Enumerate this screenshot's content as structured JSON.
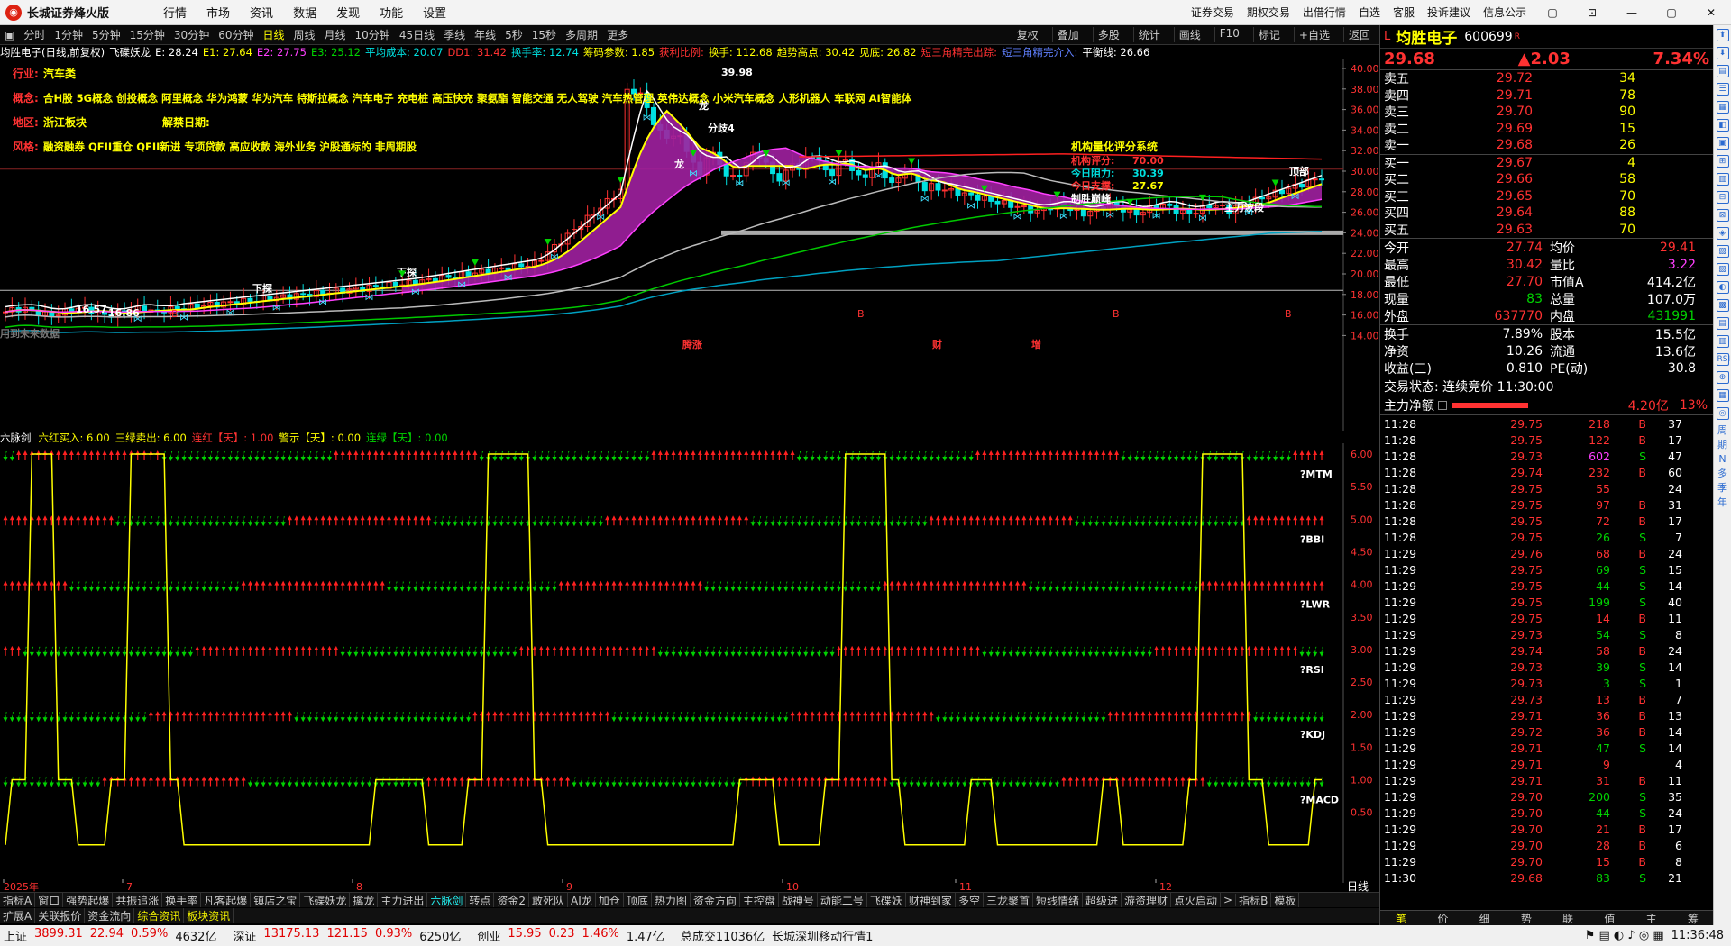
{
  "window": {
    "title": "长城证券烽火版",
    "menu": [
      "行情",
      "市场",
      "资讯",
      "数据",
      "发现",
      "功能",
      "设置"
    ],
    "right_links": [
      "证券交易",
      "期权交易",
      "出借行情",
      "自选",
      "客服",
      "投诉建议",
      "信息公示"
    ],
    "controls": [
      "▢",
      "⊡",
      "—",
      "▢",
      "✕"
    ]
  },
  "toolbar": {
    "periods": [
      "分时",
      "1分钟",
      "5分钟",
      "15分钟",
      "30分钟",
      "60分钟",
      "日线",
      "周线",
      "月线",
      "10分钟",
      "45日线",
      "季线",
      "年线",
      "5秒",
      "15秒",
      "多周期",
      "更多"
    ],
    "active": "日线",
    "right_buttons": [
      "复权",
      "叠加",
      "多股",
      "统计",
      "画线",
      "F10",
      "标记",
      "+自选",
      "返回"
    ]
  },
  "info_line": [
    {
      "t": "均胜电子(日线,前复权)",
      "c": "w"
    },
    {
      "t": "飞碟妖龙",
      "c": "w"
    },
    {
      "t": "E: 28.24",
      "c": "w"
    },
    {
      "t": "E1: 27.64",
      "c": "y"
    },
    {
      "t": "E2: 27.75",
      "c": "m"
    },
    {
      "t": "E3: 25.12",
      "c": "g"
    },
    {
      "t": "平均成本: 20.07",
      "c": "c"
    },
    {
      "t": "DD1: 31.42",
      "c": "r"
    },
    {
      "t": "换手率: 12.74",
      "c": "c"
    },
    {
      "t": "筹码参数: 1.85",
      "c": "y"
    },
    {
      "t": "获利比例:",
      "c": "r"
    },
    {
      "t": "换手: 112.68",
      "c": "y"
    },
    {
      "t": "趋势高点: 30.42",
      "c": "y"
    },
    {
      "t": "见底: 26.82",
      "c": "y"
    },
    {
      "t": "短三角精完出踪:",
      "c": "r"
    },
    {
      "t": "短三角精完介入:",
      "c": "b"
    },
    {
      "t": "平衡线: 26.66",
      "c": "w"
    }
  ],
  "annotations": {
    "industry": {
      "label": "行业:",
      "value": "汽车类"
    },
    "concepts": {
      "label": "概念:",
      "value": "合H股 5G概念 创投概念 阿里概念 华为鸿蒙 华为汽车 特斯拉概念 汽车电子 充电桩 高压快充 聚氨酯 智能交通 无人驾驶 汽车热管理 英伟达概念 小米汽车概念 人形机器人 车联网 AI智能体"
    },
    "region": {
      "label": "地区:",
      "value": "浙江板块"
    },
    "unlock": {
      "label": "解禁日期:",
      "value": ""
    },
    "style": {
      "label": "风格:",
      "value": "融资融券 QFII重仓 QFII新进 专项贷款 高应收款 海外业务 沪股通标的 非周期股"
    },
    "jigou": {
      "title": "机构量化评分系统",
      "score_label": "机构评分:",
      "score": "70.00",
      "resist_label": "今日阻力:",
      "resist": "30.39",
      "support_label": "今日支撑:",
      "support": "27.67",
      "verdict": "制胜巅峰"
    },
    "peak_label": "39.98",
    "low_labels": [
      "16.57",
      "16.86"
    ],
    "no_data": "用到未来数据",
    "bottom_marks": [
      "腾涨",
      "财",
      "增"
    ],
    "chart_words": [
      "龙",
      "龙",
      "分歧4",
      "主力波段",
      "下探",
      "下探",
      "顶部"
    ]
  },
  "price_axis": {
    "ticks": [
      "40.00",
      "38.00",
      "36.00",
      "34.00",
      "32.00",
      "30.00",
      "28.00",
      "26.00",
      "24.00",
      "22.00",
      "20.00",
      "18.00",
      "16.00",
      "14.00"
    ]
  },
  "sub_indicator": {
    "name": "六脉剑",
    "items": [
      {
        "t": "六红买入: 6.00",
        "c": "y"
      },
      {
        "t": "三绿卖出: 6.00",
        "c": "y"
      },
      {
        "t": "连红【天】: 1.00",
        "c": "r"
      },
      {
        "t": "警示【天】: 0.00",
        "c": "y"
      },
      {
        "t": "连绿【天】: 0.00",
        "c": "g"
      }
    ],
    "ticks": [
      "6.00",
      "5.50",
      "5.00",
      "4.50",
      "4.00",
      "3.50",
      "3.00",
      "2.50",
      "2.00",
      "1.50",
      "1.00",
      "0.50"
    ],
    "labels": [
      "?MTM",
      "?BBI",
      "?LWR",
      "?RSI",
      "?KDJ",
      "?MACD"
    ]
  },
  "x_axis": {
    "labels": [
      "2025年",
      "7",
      "8",
      "9",
      "10",
      "11",
      "12"
    ],
    "period": "日线"
  },
  "bottom_tabs": {
    "row1": [
      "指标A",
      "窗口",
      "强势起爆",
      "共振追涨",
      "换手率",
      "凡客起爆",
      "镇店之宝",
      "飞碟妖龙",
      "擒龙",
      "主力进出",
      "六脉剑",
      "转点",
      "资金2",
      "敢死队",
      "AI龙",
      "加仓",
      "顶底",
      "热力图",
      "资金方向",
      "主控盘",
      "战神号",
      "动能二号",
      "飞碟妖",
      "财神到家",
      "多空",
      "三龙聚首",
      "短线情绪",
      "超级进",
      "游资理财",
      "点火启动",
      ">",
      "指标B",
      "模板"
    ],
    "active": "六脉剑",
    "row2": [
      "扩展A",
      "关联报价",
      "资金流向",
      "综合资讯",
      "板块资讯"
    ],
    "row2_hl": [
      "综合资讯",
      "板块资讯"
    ]
  },
  "quote": {
    "flag": "L",
    "name": "均胜电子",
    "code": "600699",
    "rq": "R",
    "price": "29.68",
    "change": "▲2.03",
    "pct": "7.34%",
    "asks": [
      {
        "l": "卖五",
        "p": "29.72",
        "v": "34"
      },
      {
        "l": "卖四",
        "p": "29.71",
        "v": "78"
      },
      {
        "l": "卖三",
        "p": "29.70",
        "v": "90"
      },
      {
        "l": "卖二",
        "p": "29.69",
        "v": "15"
      },
      {
        "l": "卖一",
        "p": "29.68",
        "v": "26"
      }
    ],
    "bids": [
      {
        "l": "买一",
        "p": "29.67",
        "v": "4"
      },
      {
        "l": "买二",
        "p": "29.66",
        "v": "58"
      },
      {
        "l": "买三",
        "p": "29.65",
        "v": "70"
      },
      {
        "l": "买四",
        "p": "29.64",
        "v": "88"
      },
      {
        "l": "买五",
        "p": "29.63",
        "v": "70"
      }
    ],
    "stats": [
      {
        "k1": "今开",
        "v1": "27.74",
        "c1": "r",
        "k2": "均价",
        "v2": "29.41",
        "c2": "r"
      },
      {
        "k1": "最高",
        "v1": "30.42",
        "c1": "r",
        "k2": "量比",
        "v2": "3.22",
        "c2": "m"
      },
      {
        "k1": "最低",
        "v1": "27.70",
        "c1": "r",
        "k2": "市值A",
        "v2": "414.2亿",
        "c2": "w"
      },
      {
        "k1": "现量",
        "v1": "83",
        "c1": "g",
        "k2": "总量",
        "v2": "107.0万",
        "c2": "w"
      },
      {
        "k1": "外盘",
        "v1": "637770",
        "c1": "r",
        "k2": "内盘",
        "v2": "431991",
        "c2": "g"
      }
    ],
    "stats2": [
      {
        "k1": "换手",
        "v1": "7.89%",
        "k2": "股本",
        "v2": "15.5亿"
      },
      {
        "k1": "净资",
        "v1": "10.26",
        "k2": "流通",
        "v2": "13.6亿"
      },
      {
        "k1": "收益(三)",
        "v1": "0.810",
        "k2": "PE(动)",
        "v2": "30.8"
      }
    ],
    "trade_status": "交易状态: 连续竞价 11:30:00",
    "net_inflow": {
      "label": "主力净额",
      "value": "4.20亿",
      "pct": "13%",
      "ratio": 0.42
    },
    "trades": [
      [
        "11:28",
        "29.75",
        "218",
        "B",
        "37"
      ],
      [
        "11:28",
        "29.75",
        "122",
        "B",
        "17"
      ],
      [
        "11:28",
        "29.73",
        "602",
        "S",
        "47"
      ],
      [
        "11:28",
        "29.74",
        "232",
        "B",
        "60"
      ],
      [
        "11:28",
        "29.75",
        "55",
        "",
        "24"
      ],
      [
        "11:28",
        "29.75",
        "97",
        "B",
        "31"
      ],
      [
        "11:28",
        "29.75",
        "72",
        "B",
        "17"
      ],
      [
        "11:28",
        "29.75",
        "26",
        "S",
        "7"
      ],
      [
        "11:29",
        "29.76",
        "68",
        "B",
        "24"
      ],
      [
        "11:29",
        "29.75",
        "69",
        "S",
        "15"
      ],
      [
        "11:29",
        "29.75",
        "44",
        "S",
        "14"
      ],
      [
        "11:29",
        "29.75",
        "199",
        "S",
        "40"
      ],
      [
        "11:29",
        "29.75",
        "14",
        "B",
        "11"
      ],
      [
        "11:29",
        "29.73",
        "54",
        "S",
        "8"
      ],
      [
        "11:29",
        "29.74",
        "58",
        "B",
        "24"
      ],
      [
        "11:29",
        "29.73",
        "39",
        "S",
        "14"
      ],
      [
        "11:29",
        "29.73",
        "3",
        "S",
        "1"
      ],
      [
        "11:29",
        "29.73",
        "13",
        "B",
        "7"
      ],
      [
        "11:29",
        "29.71",
        "36",
        "B",
        "13"
      ],
      [
        "11:29",
        "29.72",
        "36",
        "B",
        "14"
      ],
      [
        "11:29",
        "29.71",
        "47",
        "S",
        "14"
      ],
      [
        "11:29",
        "29.71",
        "9",
        "",
        "4"
      ],
      [
        "11:29",
        "29.71",
        "31",
        "B",
        "11"
      ],
      [
        "11:29",
        "29.70",
        "200",
        "S",
        "35"
      ],
      [
        "11:29",
        "29.70",
        "44",
        "S",
        "24"
      ],
      [
        "11:29",
        "29.70",
        "21",
        "B",
        "17"
      ],
      [
        "11:29",
        "29.70",
        "28",
        "B",
        "6"
      ],
      [
        "11:29",
        "29.70",
        "15",
        "B",
        "8"
      ],
      [
        "11:30",
        "29.68",
        "83",
        "S",
        "21"
      ]
    ],
    "tabs": [
      "笔",
      "价",
      "细",
      "势",
      "联",
      "值",
      "主",
      "筹"
    ]
  },
  "sidebar": [
    "⬆",
    "⬇",
    "▤",
    "☰",
    "▦",
    "◧",
    "▣",
    "⊞",
    "▥",
    "⊟",
    "⊠",
    "◈",
    "▧",
    "▨",
    "◐",
    "▩",
    "▤",
    "▥",
    "RSI",
    "⊕",
    "▦",
    "◎"
  ],
  "sidebar_text": [
    "周",
    "期",
    "N",
    "多",
    "季",
    "年"
  ],
  "statusbar": {
    "items": [
      {
        "t": "上证",
        "c": "w"
      },
      {
        "t": "3899.31",
        "c": "r"
      },
      {
        "t": "22.94",
        "c": "r"
      },
      {
        "t": "0.59%",
        "c": "r"
      },
      {
        "t": "4632亿",
        "c": "w"
      },
      {
        "t": "深证",
        "c": "w"
      },
      {
        "t": "13175.13",
        "c": "r"
      },
      {
        "t": "121.15",
        "c": "r"
      },
      {
        "t": "0.93%",
        "c": "r"
      },
      {
        "t": "6250亿",
        "c": "w"
      },
      {
        "t": "创业",
        "c": "w"
      },
      {
        "t": "15.95",
        "c": "r"
      },
      {
        "t": "0.23",
        "c": "r"
      },
      {
        "t": "1.46%",
        "c": "r"
      },
      {
        "t": "1.47亿",
        "c": "w"
      },
      {
        "t": "总成交11036亿",
        "c": "w"
      },
      {
        "t": "长城深圳移动行情1",
        "c": "w"
      }
    ],
    "time": "11:36:48"
  },
  "colors": {
    "up": "#ff3232",
    "down": "#00d200",
    "cloud": "#a020a0",
    "ma_white": "#ffffff",
    "ma_yellow": "#ffff00",
    "ma_red": "#ff2020",
    "ma_magenta": "#ff40ff",
    "ma_green": "#00c800",
    "ma_cyan": "#00a0c0",
    "ma_gray": "#bbbbbb"
  }
}
